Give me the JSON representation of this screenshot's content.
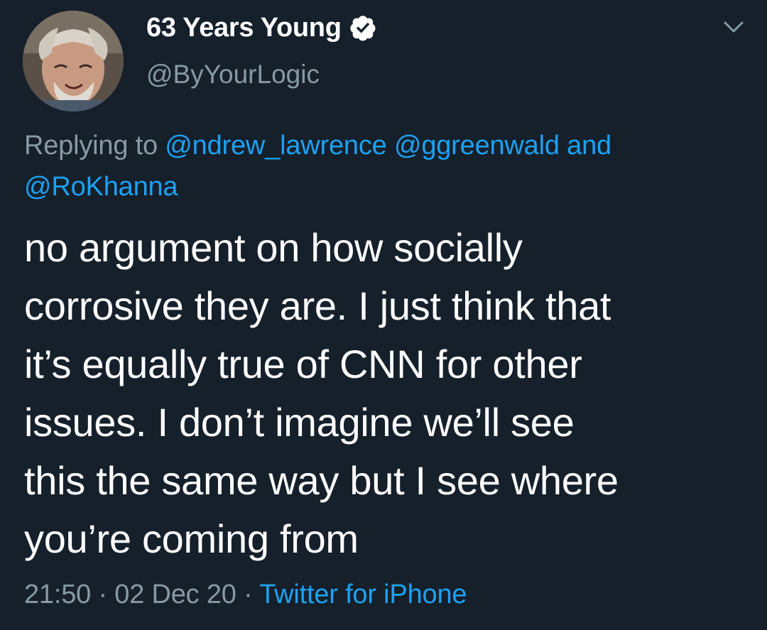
{
  "tweet": {
    "display_name": "63 Years Young",
    "verified_icon": "verified-badge-icon",
    "handle": "@ByYourLogic",
    "replying_prefix": "Replying to",
    "mentions": [
      "@ndrew_lawrence",
      "@ggreenwald",
      "@RoKhanna"
    ],
    "mentions_joiner": "and",
    "body_lines": [
      "no argument on how socially",
      "corrosive they are. I just think that",
      "it’s equally true of CNN for other",
      "issues. I don’t imagine we’ll see",
      "this the same way but I see where",
      "you’re coming from"
    ],
    "time": "21:50",
    "date": "02 Dec 20",
    "separator": "·",
    "source": "Twitter for iPhone",
    "menu_icon": "chevron-down-icon"
  },
  "colors": {
    "background": "#15202b",
    "text_primary": "#ffffff",
    "text_secondary": "#8899a6",
    "accent": "#1da1f2"
  }
}
